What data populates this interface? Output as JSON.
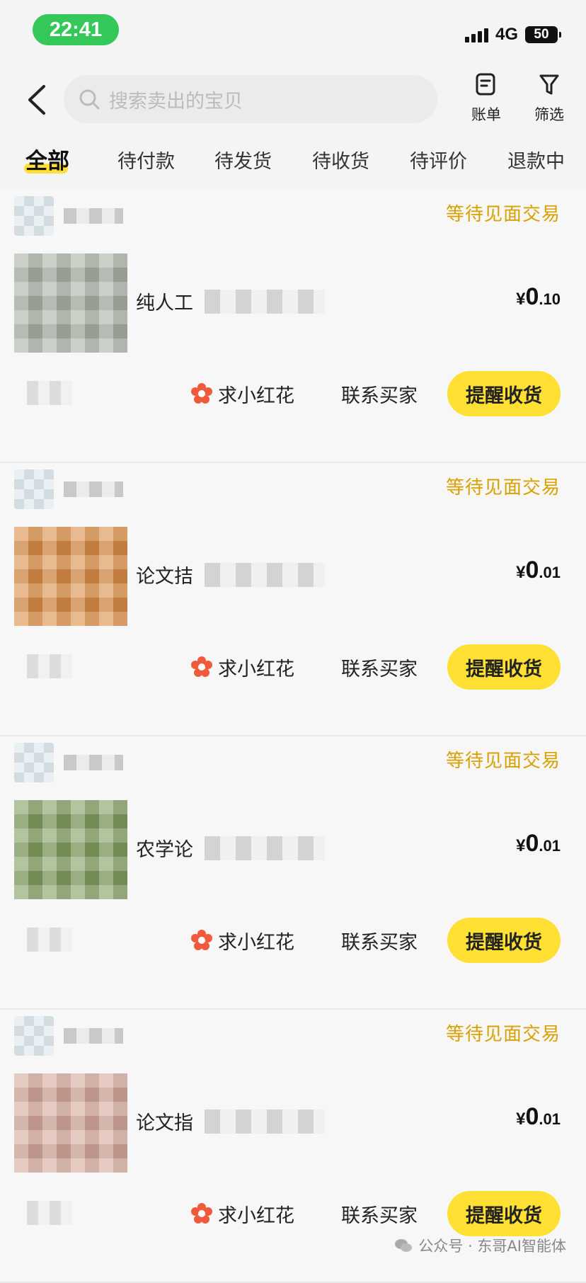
{
  "status_bar": {
    "time": "22:41",
    "network": "4G",
    "battery": "50"
  },
  "nav": {
    "search_placeholder": "搜索卖出的宝贝",
    "bill_label": "账单",
    "filter_label": "筛选"
  },
  "tabs": [
    {
      "label": "全部",
      "active": true
    },
    {
      "label": "待付款"
    },
    {
      "label": "待发货"
    },
    {
      "label": "待收货"
    },
    {
      "label": "待评价"
    },
    {
      "label": "退款中"
    }
  ],
  "orders": [
    {
      "status": "等待见面交易",
      "title": "纯人工",
      "price_currency": "¥",
      "price_int": "0",
      "price_dec": ".10"
    },
    {
      "status": "等待见面交易",
      "title": "论文拮",
      "price_currency": "¥",
      "price_int": "0",
      "price_dec": ".01"
    },
    {
      "status": "等待见面交易",
      "title": "农学论",
      "price_currency": "¥",
      "price_int": "0",
      "price_dec": ".01"
    },
    {
      "status": "等待见面交易",
      "title": "论文指",
      "price_currency": "¥",
      "price_int": "0",
      "price_dec": ".01"
    }
  ],
  "order_actions": {
    "flower": "求小红花",
    "contact": "联系买家",
    "remind": "提醒收货"
  },
  "watermark": "公众号 · 东哥AI智能体",
  "colors": {
    "accent_yellow": "#ffe033",
    "status_orange": "#d9a100",
    "time_green": "#34c759"
  }
}
